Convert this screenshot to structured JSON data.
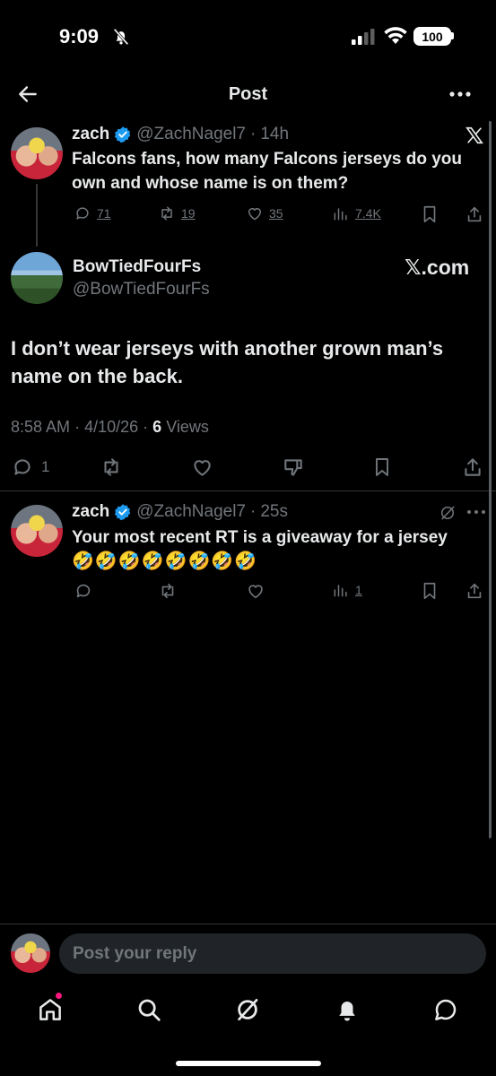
{
  "status_bar": {
    "time": "9:09",
    "battery": "100"
  },
  "header": {
    "title": "Post"
  },
  "parent_post": {
    "name": "zach",
    "handle": "@ZachNagel7",
    "sep": "·",
    "time": "14h",
    "text": "Falcons fans, how many Falcons jerseys do you own and whose name is on them?",
    "replies": "71",
    "reposts": "19",
    "likes": "35",
    "views": "7.4K"
  },
  "main_post": {
    "name": "BowTiedFourFs",
    "handle": "@BowTiedFourFs",
    "source": "𝕏.com",
    "text": "I don’t wear jerseys with another grown man’s name on the back.",
    "meta_time": "8:58 AM",
    "meta_sep1": "·",
    "meta_date": "4/10/26",
    "meta_sep2": "·",
    "meta_views_count": "6",
    "meta_views_label": "Views",
    "replies": "1"
  },
  "reply_post": {
    "name": "zach",
    "handle": "@ZachNagel7",
    "sep": "·",
    "time": "25s",
    "text": "Your most recent RT is a giveaway for a jersey",
    "emojis": "🤣🤣🤣🤣🤣🤣🤣🤣",
    "views": "1"
  },
  "composer": {
    "placeholder": "Post your reply"
  },
  "colors": {
    "background": "#000000",
    "verified": "#1d9bf0",
    "muted": "#71767b",
    "notification_dot": "#f91880"
  },
  "icons": [
    "back-arrow-icon",
    "more-icon",
    "x-logo-icon",
    "reply-icon",
    "repost-icon",
    "like-icon",
    "views-icon",
    "bookmark-icon",
    "share-icon",
    "dislike-icon",
    "grok-icon",
    "home-icon",
    "search-icon",
    "bell-icon",
    "messages-icon"
  ]
}
